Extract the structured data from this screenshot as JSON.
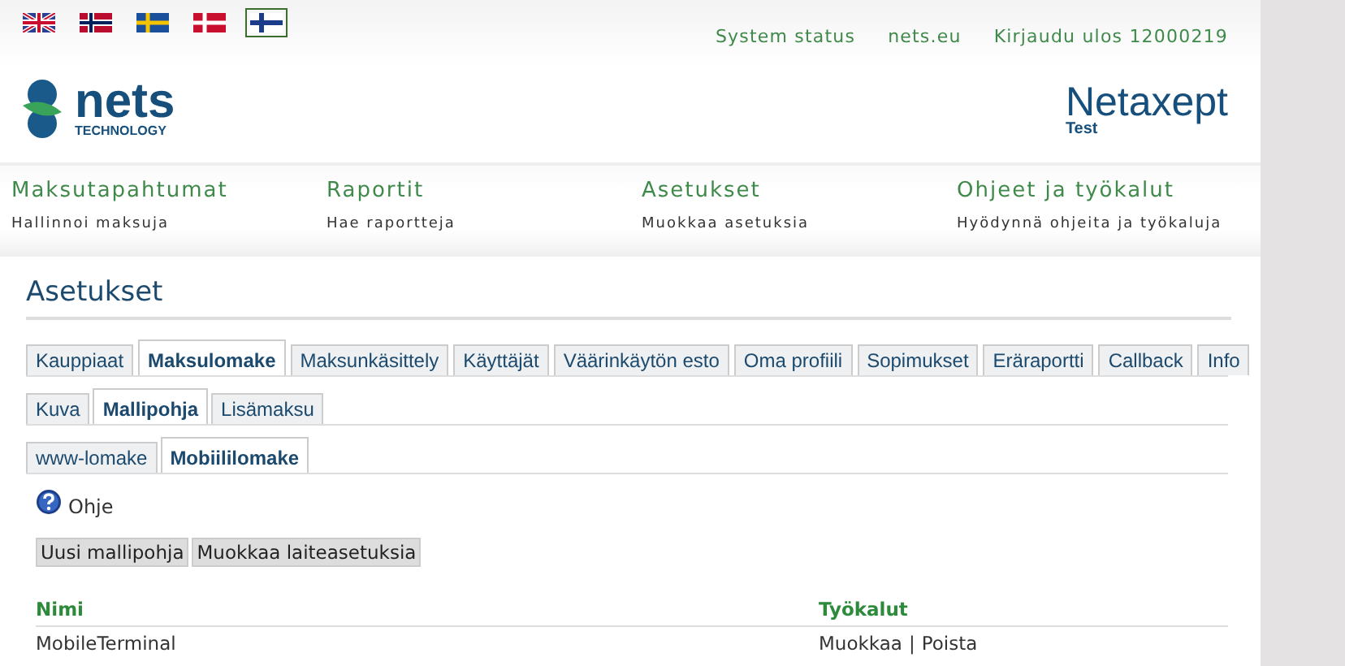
{
  "flags": [
    {
      "kind": "uk",
      "selected": false
    },
    {
      "kind": "no",
      "selected": false
    },
    {
      "kind": "se",
      "selected": false
    },
    {
      "kind": "dk",
      "selected": false
    },
    {
      "kind": "fi",
      "selected": true
    }
  ],
  "top_links": [
    "System status",
    "nets.eu",
    "Kirjaudu ulos 12000219"
  ],
  "logo": {
    "name": "nets",
    "sub": "TECHNOLOGY"
  },
  "product": {
    "name": "Netaxept",
    "env": "Test"
  },
  "nav": [
    {
      "title": "Maksutapahtumat",
      "subtitle": "Hallinnoi maksuja"
    },
    {
      "title": "Raportit",
      "subtitle": "Hae raportteja"
    },
    {
      "title": "Asetukset",
      "subtitle": "Muokkaa asetuksia"
    },
    {
      "title": "Ohjeet ja työkalut",
      "subtitle": "Hyödynnä ohjeita ja työkaluja"
    }
  ],
  "page_title": "Asetukset",
  "tabs": [
    {
      "label": "Kauppiaat",
      "selected": false
    },
    {
      "label": "Maksulomake",
      "selected": true
    },
    {
      "label": "Maksunkäsittely",
      "selected": false
    },
    {
      "label": "Käyttäjät",
      "selected": false
    },
    {
      "label": "Väärinkäytön esto",
      "selected": false
    },
    {
      "label": "Oma profiili",
      "selected": false
    },
    {
      "label": "Sopimukset",
      "selected": false
    },
    {
      "label": "Eräraportti",
      "selected": false
    },
    {
      "label": "Callback",
      "selected": false
    },
    {
      "label": "Info",
      "selected": false
    }
  ],
  "subtabs": [
    {
      "label": "Kuva",
      "selected": false
    },
    {
      "label": "Mallipohja",
      "selected": true
    },
    {
      "label": "Lisämaksu",
      "selected": false
    }
  ],
  "subsubtabs": [
    {
      "label": "www-lomake",
      "selected": false
    },
    {
      "label": "Mobiililomake",
      "selected": true
    }
  ],
  "help": "Ohje",
  "buttons": [
    "Uusi mallipohja",
    "Muokkaa laiteasetuksia"
  ],
  "table": {
    "columns": [
      "Nimi",
      "Työkalut"
    ],
    "rows": [
      {
        "name": "MobileTerminal",
        "actions": [
          "Muokkaa",
          "Poista"
        ],
        "separator": "|"
      }
    ]
  }
}
